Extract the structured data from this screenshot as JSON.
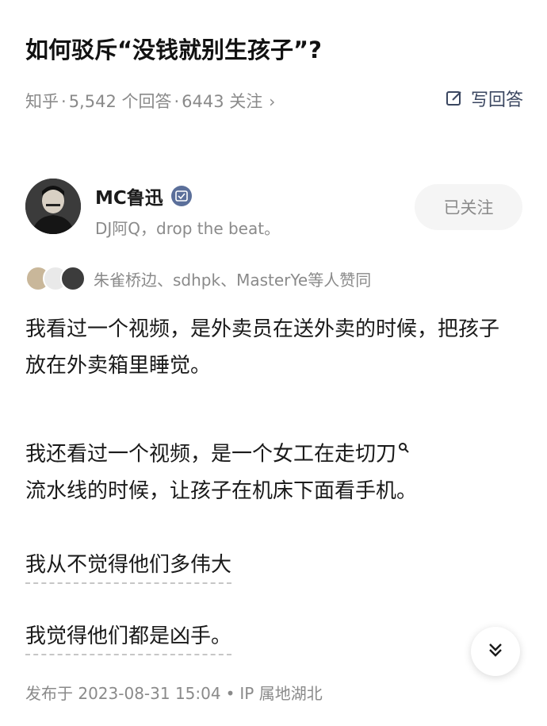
{
  "question": {
    "title": "如何驳斥“没钱就别生孩子”?",
    "source": "知乎",
    "answer_count": "5,542 个回答",
    "follower_count": "6443 关注",
    "write_answer_label": "写回答"
  },
  "author": {
    "name": "MC鲁迅",
    "signature": "DJ阿Q，drop the beat。",
    "follow_label": "已关注"
  },
  "voters": {
    "text": "朱雀桥边、sdhpk、MasterYe等人赞同"
  },
  "content": {
    "paragraph_1": "我看过一个视频，是外卖员在送外卖的时候，把孩子放在外卖箱里睡觉。",
    "paragraph_2": "我还看过一个视频，是一个女工在走切刀",
    "paragraph_2_b": "流水线的时候，让孩子在机床下面看手机。",
    "line_3": "我从不觉得他们多伟大",
    "line_4": "我觉得他们都是凶手。"
  },
  "footer": {
    "published": "发布于 2023-08-31 15:04",
    "ip": "IP 属地湖北"
  },
  "icons": {
    "write": "edit-icon",
    "badge": "verified-badge-icon",
    "expand": "double-chevron-down-icon"
  }
}
